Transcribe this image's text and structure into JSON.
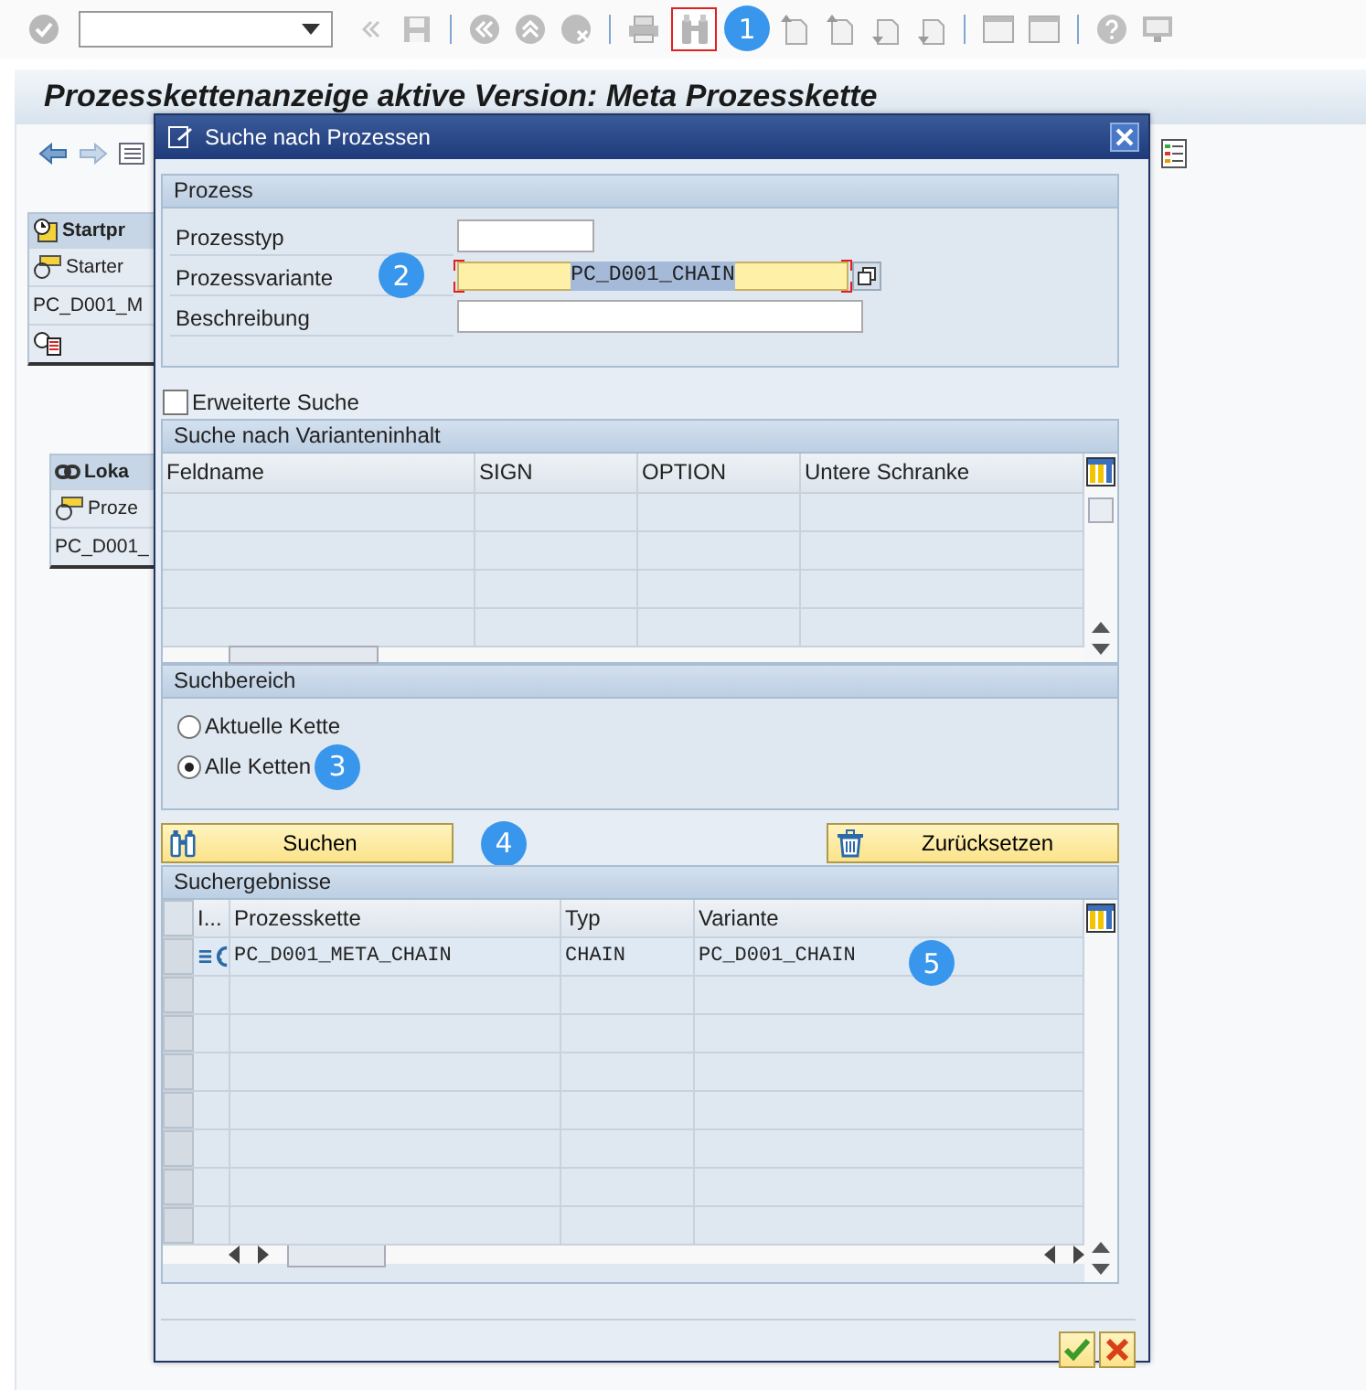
{
  "toolbar_buttons": [
    {
      "kind": "check",
      "highlighted": false
    },
    {
      "kind": "command-field"
    },
    {
      "kind": "double-left",
      "highlighted": false
    },
    {
      "kind": "save",
      "highlighted": false
    },
    {
      "kind": "separator"
    },
    {
      "kind": "back-circle",
      "highlighted": false
    },
    {
      "kind": "up-circle",
      "highlighted": false
    },
    {
      "kind": "cancel-circle",
      "highlighted": false
    },
    {
      "kind": "separator"
    },
    {
      "kind": "print",
      "highlighted": false
    },
    {
      "kind": "find",
      "highlighted": true,
      "callout": "1"
    },
    {
      "kind": "page-up",
      "highlighted": false
    },
    {
      "kind": "page-up",
      "highlighted": false
    },
    {
      "kind": "page-down",
      "highlighted": false
    },
    {
      "kind": "page-down",
      "highlighted": false
    },
    {
      "kind": "separator"
    },
    {
      "kind": "window",
      "highlighted": false
    },
    {
      "kind": "window",
      "highlighted": false
    },
    {
      "kind": "separator"
    },
    {
      "kind": "help",
      "highlighted": false
    },
    {
      "kind": "monitor",
      "highlighted": false
    }
  ],
  "title": "Prozesskettenanzeige aktive Version: Meta Prozesskette",
  "canvas_nodes": [
    {
      "kind": "start",
      "header": "Startpr",
      "rows": [
        "Starter",
        "PC_D001_M"
      ]
    },
    {
      "kind": "local",
      "header": "Loka",
      "rows": [
        "Proze",
        "PC_D001_"
      ]
    }
  ],
  "dialog": {
    "title": "Suche nach Prozessen",
    "process_group": {
      "title": "Prozess",
      "fields": [
        {
          "label": "Prozesstyp",
          "kind": "short",
          "focused": false
        },
        {
          "label": "Prozessvariante",
          "value": "PC_D001_CHAIN",
          "kind": "lookup",
          "focused": true,
          "callout": "2"
        },
        {
          "label": "Beschreibung",
          "kind": "long",
          "focused": false
        }
      ]
    },
    "extended_search": {
      "label": "Erweiterte Suche",
      "checked": false
    },
    "variant_table": {
      "title": "Suche nach Varianteninhalt",
      "columns": [
        "Feldname",
        "SIGN",
        "OPTION",
        "Untere Schranke"
      ]
    },
    "search_scope": {
      "title": "Suchbereich",
      "callout": "3",
      "options": [
        {
          "label": "Aktuelle Kette",
          "selected": false
        },
        {
          "label": "Alle Ketten",
          "selected": true
        }
      ]
    },
    "actions": {
      "callout": "4",
      "buttons": [
        {
          "label": "Suchen",
          "kind": "search"
        },
        {
          "label": "Zurücksetzen",
          "kind": "reset"
        }
      ]
    },
    "results": {
      "title": "Suchergebnisse",
      "columns": [
        "I...",
        "Prozesskette",
        "Typ",
        "Variante"
      ],
      "rows": [
        {
          "kind": "chain",
          "cells": [
            "",
            "PC_D001_META_CHAIN",
            "CHAIN",
            "PC_D001_CHAIN"
          ],
          "callout": "5",
          "selected": false
        }
      ]
    },
    "footer_buttons": [
      {
        "kind": "confirm"
      },
      {
        "kind": "cancel"
      }
    ]
  }
}
